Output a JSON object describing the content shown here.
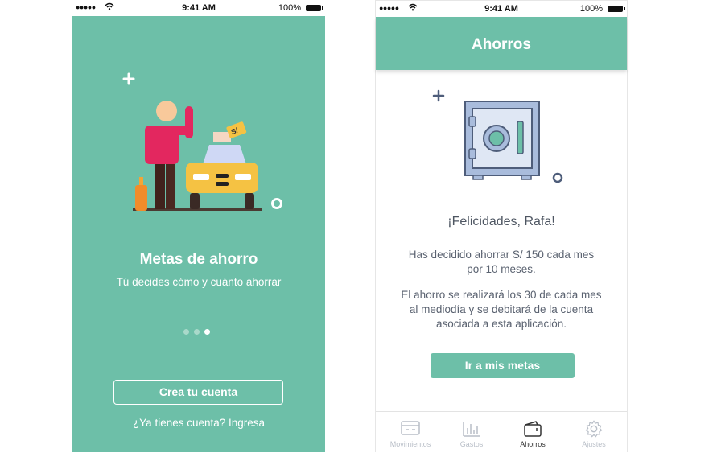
{
  "colors": {
    "accent": "#6dbfa8",
    "text_dark": "#4e5662",
    "inactive": "#b8bec7"
  },
  "statusbar": {
    "signal": "●●●●●",
    "time": "9:41 AM",
    "battery": "100%"
  },
  "left": {
    "title": "Metas de ahorro",
    "subtitle": "Tú decides cómo y cuánto ahorrar",
    "price_tag": "S/",
    "pager": {
      "pages": 3,
      "active_index": 3
    },
    "create_account": "Crea tu cuenta",
    "login_prompt": "¿Ya tienes cuenta? Ingresa"
  },
  "right": {
    "header_title": "Ahorros",
    "congrats": "¡Felicidades, Rafa!",
    "message_1": "Has decidido ahorrar S/ 150 cada mes por 10 meses.",
    "message_2": "El ahorro se realizará los 30 de cada mes al mediodía y se debitará de la cuenta asociada a esta aplicación.",
    "cta": "Ir a mis metas",
    "tabs": [
      {
        "label": "Movimientos",
        "icon": "card-icon",
        "active": false
      },
      {
        "label": "Gastos",
        "icon": "bar-chart-icon",
        "active": false
      },
      {
        "label": "Ahorros",
        "icon": "wallet-icon",
        "active": true
      },
      {
        "label": "Ajustes",
        "icon": "gear-icon",
        "active": false
      }
    ]
  }
}
